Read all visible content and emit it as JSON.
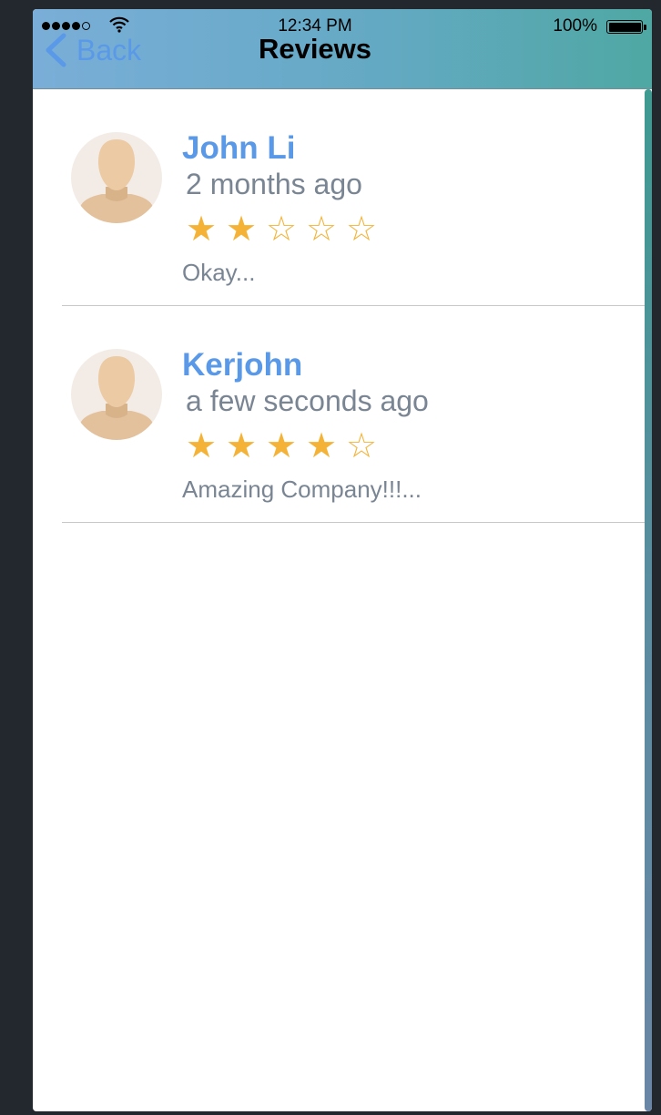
{
  "status_bar": {
    "signal_dots": [
      true,
      true,
      true,
      true,
      false
    ],
    "time": "12:34 PM",
    "battery": "100%"
  },
  "nav": {
    "back_label": "Back",
    "title": "Reviews"
  },
  "reviews": [
    {
      "name": "John Li",
      "time": "2 months ago",
      "rating": 2,
      "max_rating": 5,
      "comment": "Okay..."
    },
    {
      "name": "Kerjohn",
      "time": "a few seconds ago",
      "rating": 4,
      "max_rating": 5,
      "comment": "Amazing Company!!!..."
    }
  ],
  "colors": {
    "accent": "#5a99e8",
    "star": "#f4b336",
    "muted_text": "#7a8593",
    "navbar_gradient": [
      "#7aaed8",
      "#4fa8a3"
    ],
    "page_background": "#23282e"
  },
  "icons": {
    "back": "chevron-left-icon",
    "avatar": "default-user-avatar-icon",
    "star_filled": "★",
    "star_empty": "☆"
  }
}
